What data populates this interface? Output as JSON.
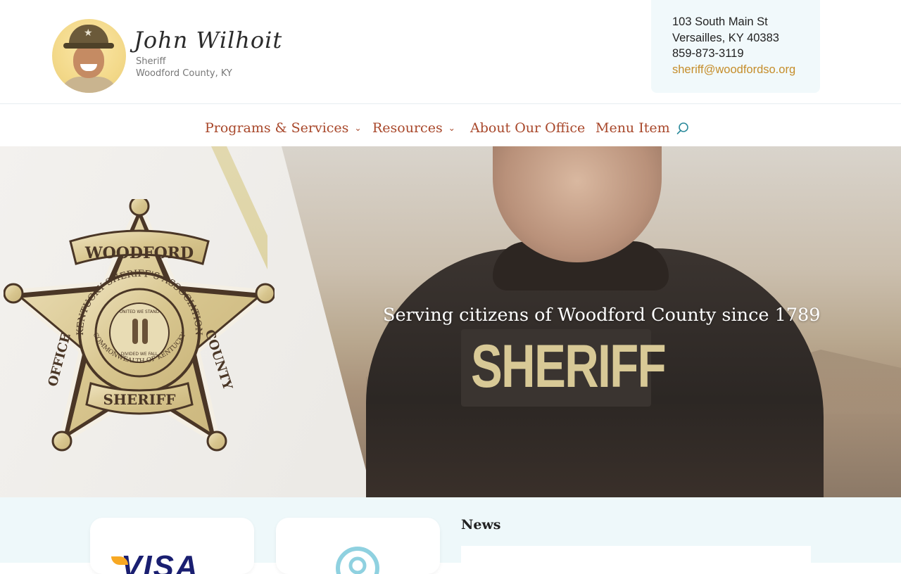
{
  "header": {
    "signature": "John Wilhoit",
    "title": "Sheriff",
    "county": "Woodford County, KY",
    "avatar_icon": "sheriff-portrait"
  },
  "contact": {
    "street": "103 South Main St",
    "city": "Versailles, KY 40383",
    "phone": "859-873-3119",
    "email": "sheriff@woodfordso.org"
  },
  "nav": {
    "items": [
      {
        "label": "Programs & Services",
        "has_dropdown": true
      },
      {
        "label": "Resources",
        "has_dropdown": true
      },
      {
        "label": "About Our Office",
        "has_dropdown": false
      },
      {
        "label": "Menu Item",
        "has_dropdown": false
      }
    ],
    "search_icon": "search-icon"
  },
  "hero": {
    "tagline": "Serving citizens of Woodford County since 1789",
    "patch_text": "SHERIFF",
    "badge": {
      "top": "WOODFORD",
      "left": "OFFICE",
      "right": "COUNTY",
      "bottom": "SHERIFF",
      "ring_outer": "KENTUCKY SHERIFF'S ASSOCIATION",
      "ring_inner": "COMMONWEALTH OF KENTUCKY",
      "motto_top": "UNITED WE STAND",
      "motto_bottom": "DIVIDED WE FALL"
    }
  },
  "lower": {
    "visa_label": "VISA",
    "news_heading": "News"
  },
  "colors": {
    "accent": "#a8472a",
    "email": "#c58d2a",
    "contact_bg": "#f1f9fb",
    "section_bg": "#eef8fa"
  }
}
